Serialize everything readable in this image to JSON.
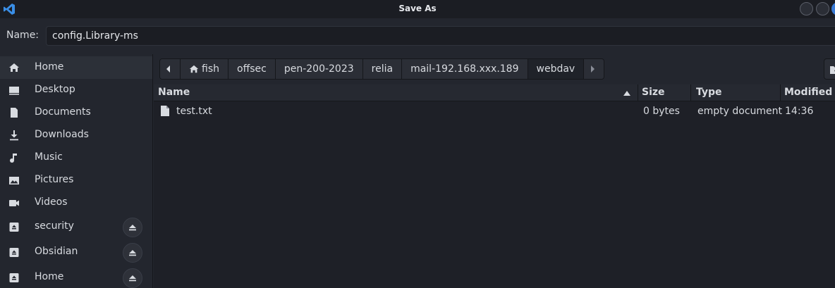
{
  "window": {
    "title": "Save As",
    "app_icon": "vscode-icon"
  },
  "name_row": {
    "label": "Name:",
    "value": "config.Library-ms"
  },
  "sidebar": {
    "items": [
      {
        "label": "Home",
        "icon": "home-icon",
        "active": true
      },
      {
        "label": "Desktop",
        "icon": "desktop-icon"
      },
      {
        "label": "Documents",
        "icon": "document-icon"
      },
      {
        "label": "Downloads",
        "icon": "download-icon"
      },
      {
        "label": "Music",
        "icon": "music-icon"
      },
      {
        "label": "Pictures",
        "icon": "picture-icon"
      },
      {
        "label": "Videos",
        "icon": "video-icon"
      },
      {
        "label": "security",
        "icon": "drive-icon",
        "eject": true
      },
      {
        "label": "Obsidian",
        "icon": "drive-icon",
        "eject": true
      },
      {
        "label": "Home",
        "icon": "drive-icon",
        "eject": true
      }
    ]
  },
  "breadcrumbs": [
    "fish",
    "offsec",
    "pen-200-2023",
    "relia",
    "mail-192.168.xxx.189",
    "webdav"
  ],
  "breadcrumb_current": "webdav",
  "columns": {
    "name": "Name",
    "size": "Size",
    "type": "Type",
    "modified": "Modified"
  },
  "files": [
    {
      "name": "test.txt",
      "size": "0 bytes",
      "type": "empty document",
      "modified": "14:36"
    }
  ],
  "colors": {
    "accent": "#3a7bd5",
    "background": "#23262e",
    "list_background": "#1e2027"
  }
}
